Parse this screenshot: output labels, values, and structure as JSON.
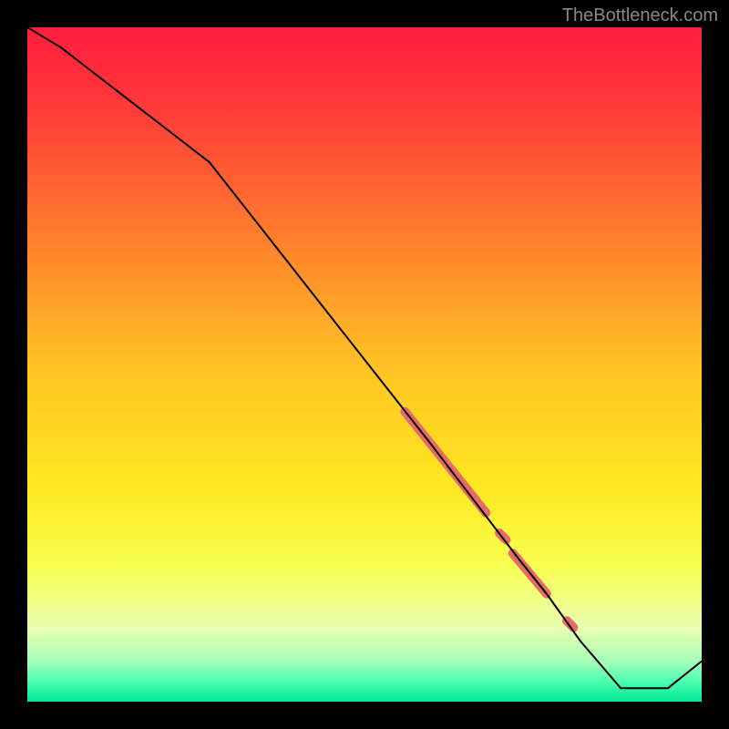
{
  "watermark": "TheBottleneck.com",
  "chart_data": {
    "type": "line",
    "title": "",
    "xlabel": "",
    "ylabel": "",
    "xlim": [
      0,
      100
    ],
    "ylim": [
      0,
      100
    ],
    "background_gradient": {
      "stops": [
        {
          "pos": 0.0,
          "color": "#ff1d3e"
        },
        {
          "pos": 0.12,
          "color": "#ff3a3a"
        },
        {
          "pos": 0.3,
          "color": "#ff7a2d"
        },
        {
          "pos": 0.5,
          "color": "#ffc225"
        },
        {
          "pos": 0.68,
          "color": "#ffe820"
        },
        {
          "pos": 0.8,
          "color": "#f7ff50"
        },
        {
          "pos": 0.89,
          "color": "#e8ffb0"
        },
        {
          "pos": 0.94,
          "color": "#a8ffb8"
        },
        {
          "pos": 0.97,
          "color": "#4cffb0"
        },
        {
          "pos": 1.0,
          "color": "#00e694"
        }
      ]
    },
    "series": [
      {
        "name": "bottleneck-curve",
        "color": "#000000",
        "width": 2,
        "x": [
          0,
          5,
          27,
          60,
          73,
          77,
          82,
          88,
          95,
          100
        ],
        "y": [
          100,
          97,
          80,
          38,
          21,
          16,
          9,
          2,
          2,
          6
        ]
      }
    ],
    "highlighted_segments": [
      {
        "name": "confidence-band-1",
        "color": "#e86a6a",
        "width": 10,
        "x": [
          56,
          68
        ],
        "y": [
          43,
          28
        ]
      },
      {
        "name": "confidence-dot-1",
        "color": "#e86a6a",
        "width": 10,
        "x": [
          70,
          71
        ],
        "y": [
          25,
          24
        ]
      },
      {
        "name": "confidence-band-2",
        "color": "#e86a6a",
        "width": 10,
        "x": [
          72,
          77
        ],
        "y": [
          22,
          16
        ]
      },
      {
        "name": "confidence-dot-2",
        "color": "#e86a6a",
        "width": 10,
        "x": [
          80,
          81
        ],
        "y": [
          12,
          11
        ]
      }
    ]
  }
}
